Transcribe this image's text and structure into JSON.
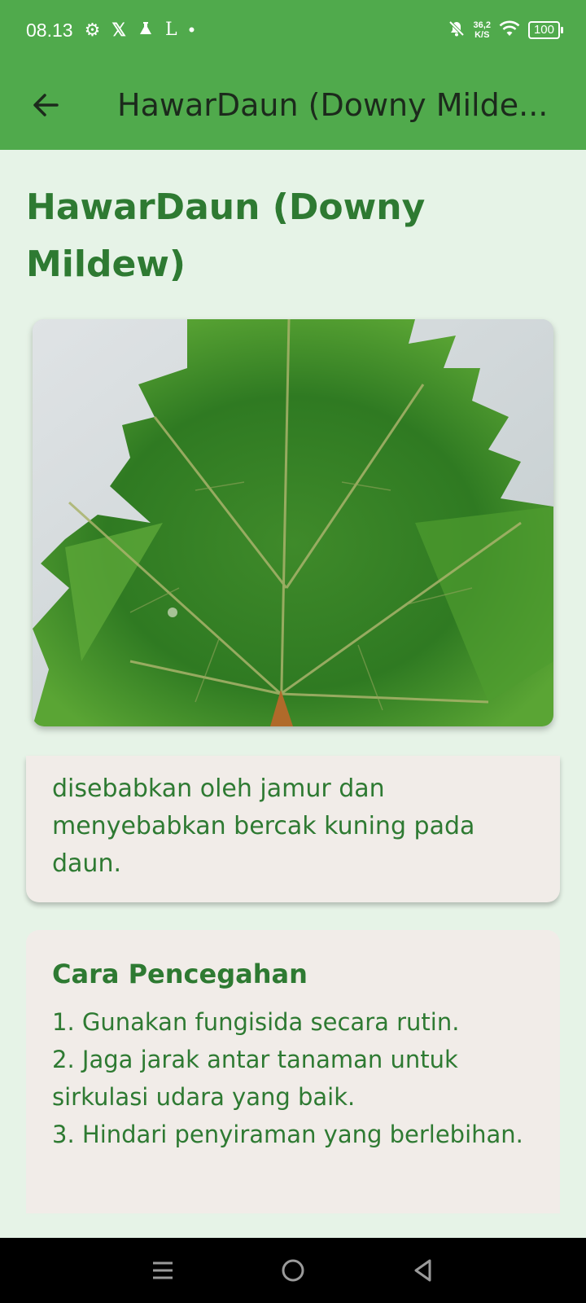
{
  "status_bar": {
    "time": "08.13",
    "net_speed_value": "36,2",
    "net_speed_unit": "K/S",
    "battery": "100",
    "icons": [
      "settings-icon",
      "x-icon",
      "flask-icon",
      "l-icon",
      "dot-icon",
      "mute-icon",
      "wifi-icon",
      "battery-icon"
    ]
  },
  "app_bar": {
    "title": "HawarDaun (Downy Milde..."
  },
  "content": {
    "page_title": "HawarDaun (Downy Mildew)",
    "description": "disebabkan oleh jamur dan menyebabkan bercak kuning pada daun.",
    "prevention": {
      "heading": "Cara Pencegahan",
      "items": [
        "1. Gunakan fungisida secara rutin.",
        "2. Jaga jarak antar tanaman untuk sirkulasi udara yang baik.",
        "3. Hindari penyiraman yang berlebihan."
      ]
    }
  },
  "colors": {
    "primary": "#50aa4c",
    "title_green": "#2e7a32",
    "background": "#e6f3e7",
    "card": "#f1ece8"
  }
}
